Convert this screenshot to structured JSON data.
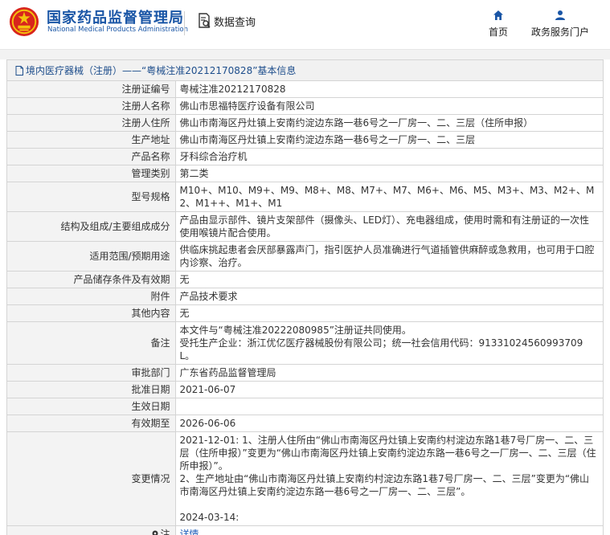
{
  "header": {
    "org_name_cn": "国家药品监督管理局",
    "org_name_en": "National Medical Products Administration",
    "query_label": "数据查询",
    "nav": [
      {
        "label": "首页",
        "icon": "home-icon"
      },
      {
        "label": "政务服务门户",
        "icon": "user-icon"
      }
    ]
  },
  "panel": {
    "breadcrumb": "境内医疗器械（注册）——“粤械注准20212170828”基本信息"
  },
  "rows": [
    {
      "key": "注册证编号",
      "value": "粤械注准20212170828"
    },
    {
      "key": "注册人名称",
      "value": "佛山市思福特医疗设备有限公司"
    },
    {
      "key": "注册人住所",
      "value": "佛山市南海区丹灶镇上安南约淀边东路一巷6号之一厂房一、二、三层（住所申报）"
    },
    {
      "key": "生产地址",
      "value": "佛山市南海区丹灶镇上安南约淀边东路一巷6号之一厂房一、二、三层"
    },
    {
      "key": "产品名称",
      "value": "牙科综合治疗机"
    },
    {
      "key": "管理类别",
      "value": "第二类"
    },
    {
      "key": "型号规格",
      "value": "M10+、M10、M9+、M9、M8+、M8、M7+、M7、M6+、M6、M5、M3+、M3、M2+、M2、M1++、M1+、M1"
    },
    {
      "key": "结构及组成/主要组成成分",
      "value": "产品由显示部件、镜片支架部件（摄像头、LED灯）、充电器组成，使用时需和有注册证的一次性使用喉镜片配合使用。"
    },
    {
      "key": "适用范围/预期用途",
      "value": "供临床挑起患者会厌部暴露声门，指引医护人员准确进行气道插管供麻醉或急救用，也可用于口腔内诊察、治疗。"
    },
    {
      "key": "产品储存条件及有效期",
      "value": "无"
    },
    {
      "key": "附件",
      "value": "产品技术要求"
    },
    {
      "key": "其他内容",
      "value": "无"
    },
    {
      "key": "备注",
      "value_lines": [
        "本文件与“粤械注准20222080985”注册证共同使用。",
        "受托生产企业：浙江优亿医疗器械股份有限公司；统一社会信用代码：91331024560993709L。"
      ]
    },
    {
      "key": "审批部门",
      "value": "广东省药品监督管理局"
    },
    {
      "key": "批准日期",
      "value": "2021-06-07"
    },
    {
      "key": "生效日期",
      "value": ""
    },
    {
      "key": "有效期至",
      "value": "2026-06-06"
    },
    {
      "key": "变更情况",
      "value_lines": [
        "2021-12-01: 1、注册人住所由“佛山市南海区丹灶镇上安南约村淀边东路1巷7号厂房一、二、三层（住所申报）”变更为“佛山市南海区丹灶镇上安南约淀边东路一巷6号之一厂房一、二、三层（住所申报）”。",
        "2、生产地址由“佛山市南海区丹灶镇上安南约村淀边东路1巷7号厂房一、二、三层”变更为“佛山市南海区丹灶镇上安南约淀边东路一巷6号之一厂房一、二、三层”。",
        "",
        "2024-03-14:"
      ]
    },
    {
      "key": "注",
      "key_icon": "pin-icon",
      "value": "详情"
    }
  ],
  "colors": {
    "brand": "#1a56a6",
    "link": "#1e5dba",
    "label_bg": "#f3f3f3",
    "logo_red": "#d8251d",
    "logo_gold": "#f4c20d"
  }
}
